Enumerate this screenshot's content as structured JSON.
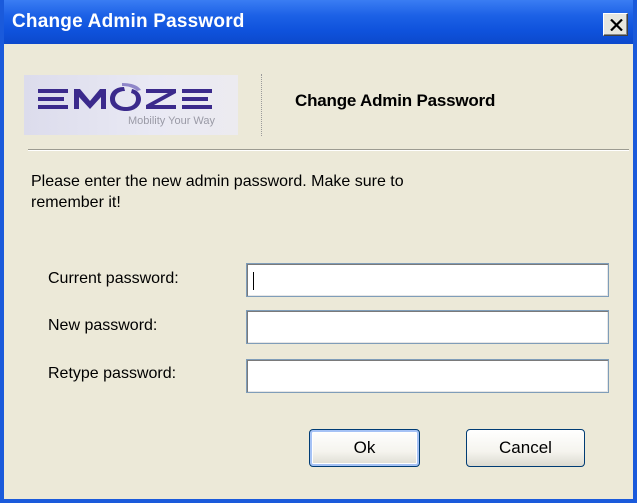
{
  "window": {
    "title": "Change Admin Password",
    "close_glyph": "✕"
  },
  "logo": {
    "brand": "EMOZE",
    "tagline": "Mobility Your Way",
    "colors": {
      "purple": "#3b2a8c",
      "lavender": "#8f86c8"
    }
  },
  "header": {
    "title": "Change Admin Password"
  },
  "instructions": "Please enter the new admin password. Make sure to remember it!",
  "fields": [
    {
      "label": "Current password:",
      "value": "",
      "placeholder": ""
    },
    {
      "label": "New password:",
      "value": "",
      "placeholder": ""
    },
    {
      "label": "Retype password:",
      "value": "",
      "placeholder": ""
    }
  ],
  "buttons": {
    "ok": "Ok",
    "cancel": "Cancel"
  },
  "colors": {
    "titlebar": "#0f52dc",
    "client_background": "#ece9d8",
    "input_border": "#7f9db9",
    "button_border": "#003c74",
    "default_button_focus": "#a5c2f5"
  },
  "icons": {
    "close": "close-icon"
  }
}
